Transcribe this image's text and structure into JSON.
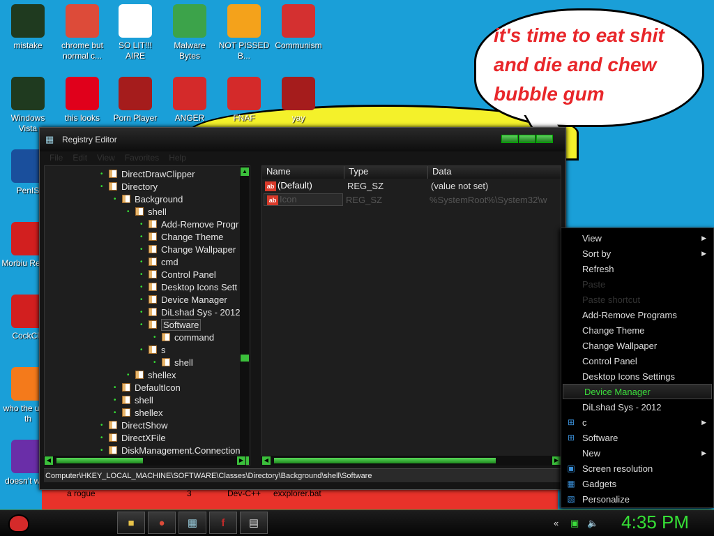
{
  "bubble_text": "it's time to eat shit and die and chew bubble gum",
  "desktop_icons": [
    {
      "label": "mistake",
      "icon": "green-orb-icon",
      "color": "#1f3a1f"
    },
    {
      "label": "chrome but normal c...",
      "icon": "chrome-icon",
      "color": "#dd4b39"
    },
    {
      "label": "SO LIT!!! AIRE",
      "icon": "cards-icon",
      "color": "#ffffff"
    },
    {
      "label": "Malware Bytes",
      "icon": "shield-icon",
      "color": "#3ca34a"
    },
    {
      "label": "NOT PISSED B...",
      "icon": "pig-icon",
      "color": "#f4a21b"
    },
    {
      "label": "Communism",
      "icon": "banner-icon",
      "color": "#d43030"
    },
    {
      "label": "Windows Vista",
      "icon": "recycle-icon",
      "color": "#1f3a1f"
    },
    {
      "label": "this looks",
      "icon": "opera-icon",
      "color": "#e0001b"
    },
    {
      "label": "Porn Player",
      "icon": "flash-icon",
      "color": "#a51c1c"
    },
    {
      "label": "ANGER",
      "icon": "angry-bird-icon",
      "color": "#d42a2a"
    },
    {
      "label": "FNAF",
      "icon": "angry-bird-icon",
      "color": "#d42a2a"
    },
    {
      "label": "yay",
      "icon": "flash-icon",
      "color": "#a51c1c"
    },
    {
      "label": "PenIS",
      "icon": "photoshop-icon",
      "color": "#1a4f9c"
    },
    {
      "label": "Morbiu Reade",
      "icon": "pdf-icon",
      "color": "#d21f1f"
    },
    {
      "label": "CockCle",
      "icon": "ccleaner-icon",
      "color": "#d21f1f"
    },
    {
      "label": "who the uses th",
      "icon": "lightning-icon",
      "color": "#f47a1b"
    },
    {
      "label": "doesn't w lol",
      "icon": "yahoo-icon",
      "color": "#6a2ea8"
    }
  ],
  "wallpaper_labels": [
    "a rogue",
    "3",
    "Dev-C++",
    "exxplorer.bat"
  ],
  "window": {
    "title": "Registry Editor",
    "menu": [
      "File",
      "Edit",
      "View",
      "Favorites",
      "Help"
    ],
    "tree": [
      {
        "label": "DirectDrawClipper",
        "level": 0
      },
      {
        "label": "Directory",
        "level": 0
      },
      {
        "label": "Background",
        "level": 1
      },
      {
        "label": "shell",
        "level": 2
      },
      {
        "label": "Add-Remove Progr",
        "level": 3
      },
      {
        "label": "Change Theme",
        "level": 3
      },
      {
        "label": "Change Wallpaper",
        "level": 3
      },
      {
        "label": "cmd",
        "level": 3
      },
      {
        "label": "Control Panel",
        "level": 3
      },
      {
        "label": "Desktop Icons Sett",
        "level": 3
      },
      {
        "label": "Device Manager",
        "level": 3
      },
      {
        "label": "DiLshad Sys - 2012",
        "level": 3
      },
      {
        "label": "Software",
        "level": 3,
        "selected": true
      },
      {
        "label": "command",
        "level": 4
      },
      {
        "label": "s",
        "level": 3
      },
      {
        "label": "shell",
        "level": 4
      },
      {
        "label": "shellex",
        "level": 2
      },
      {
        "label": "DefaultIcon",
        "level": 1
      },
      {
        "label": "shell",
        "level": 1
      },
      {
        "label": "shellex",
        "level": 1
      },
      {
        "label": "DirectShow",
        "level": 0
      },
      {
        "label": "DirectXFile",
        "level": 0
      },
      {
        "label": "DiskManagement.Connection",
        "level": 0
      }
    ],
    "columns": [
      "Name",
      "Type",
      "Data"
    ],
    "values": [
      {
        "name": "(Default)",
        "type": "REG_SZ",
        "data": "(value not set)"
      },
      {
        "name": "Icon",
        "type": "REG_SZ",
        "data": "%SystemRoot%\\System32\\w"
      }
    ],
    "status_path": "Computer\\HKEY_LOCAL_MACHINE\\SOFTWARE\\Classes\\Directory\\Background\\shell\\Software"
  },
  "context_menu": [
    {
      "label": "View",
      "submenu": true
    },
    {
      "label": "Sort by",
      "submenu": true
    },
    {
      "label": "Refresh"
    },
    {
      "label": "Paste",
      "disabled": true
    },
    {
      "label": "Paste shortcut",
      "disabled": true
    },
    {
      "label": "Add-Remove Programs"
    },
    {
      "label": "Change Theme"
    },
    {
      "label": "Change Wallpaper"
    },
    {
      "label": "Control Panel"
    },
    {
      "label": "Desktop Icons Settings"
    },
    {
      "label": "Device Manager",
      "highlighted": true
    },
    {
      "label": "DiLshad Sys - 2012"
    },
    {
      "label": "c",
      "submenu": true,
      "icon": "windows-icon"
    },
    {
      "label": "Software",
      "icon": "windows-icon"
    },
    {
      "label": "New",
      "submenu": true
    },
    {
      "label": "Screen resolution",
      "icon": "monitor-icon"
    },
    {
      "label": "Gadgets",
      "icon": "gadgets-icon"
    },
    {
      "label": "Personalize",
      "icon": "personalize-icon"
    }
  ],
  "taskbar": {
    "buttons": [
      "explorer-icon",
      "chrome-icon",
      "regedit-icon",
      "flash-icon",
      "notepad-icon"
    ],
    "clock": "4:35 PM"
  }
}
